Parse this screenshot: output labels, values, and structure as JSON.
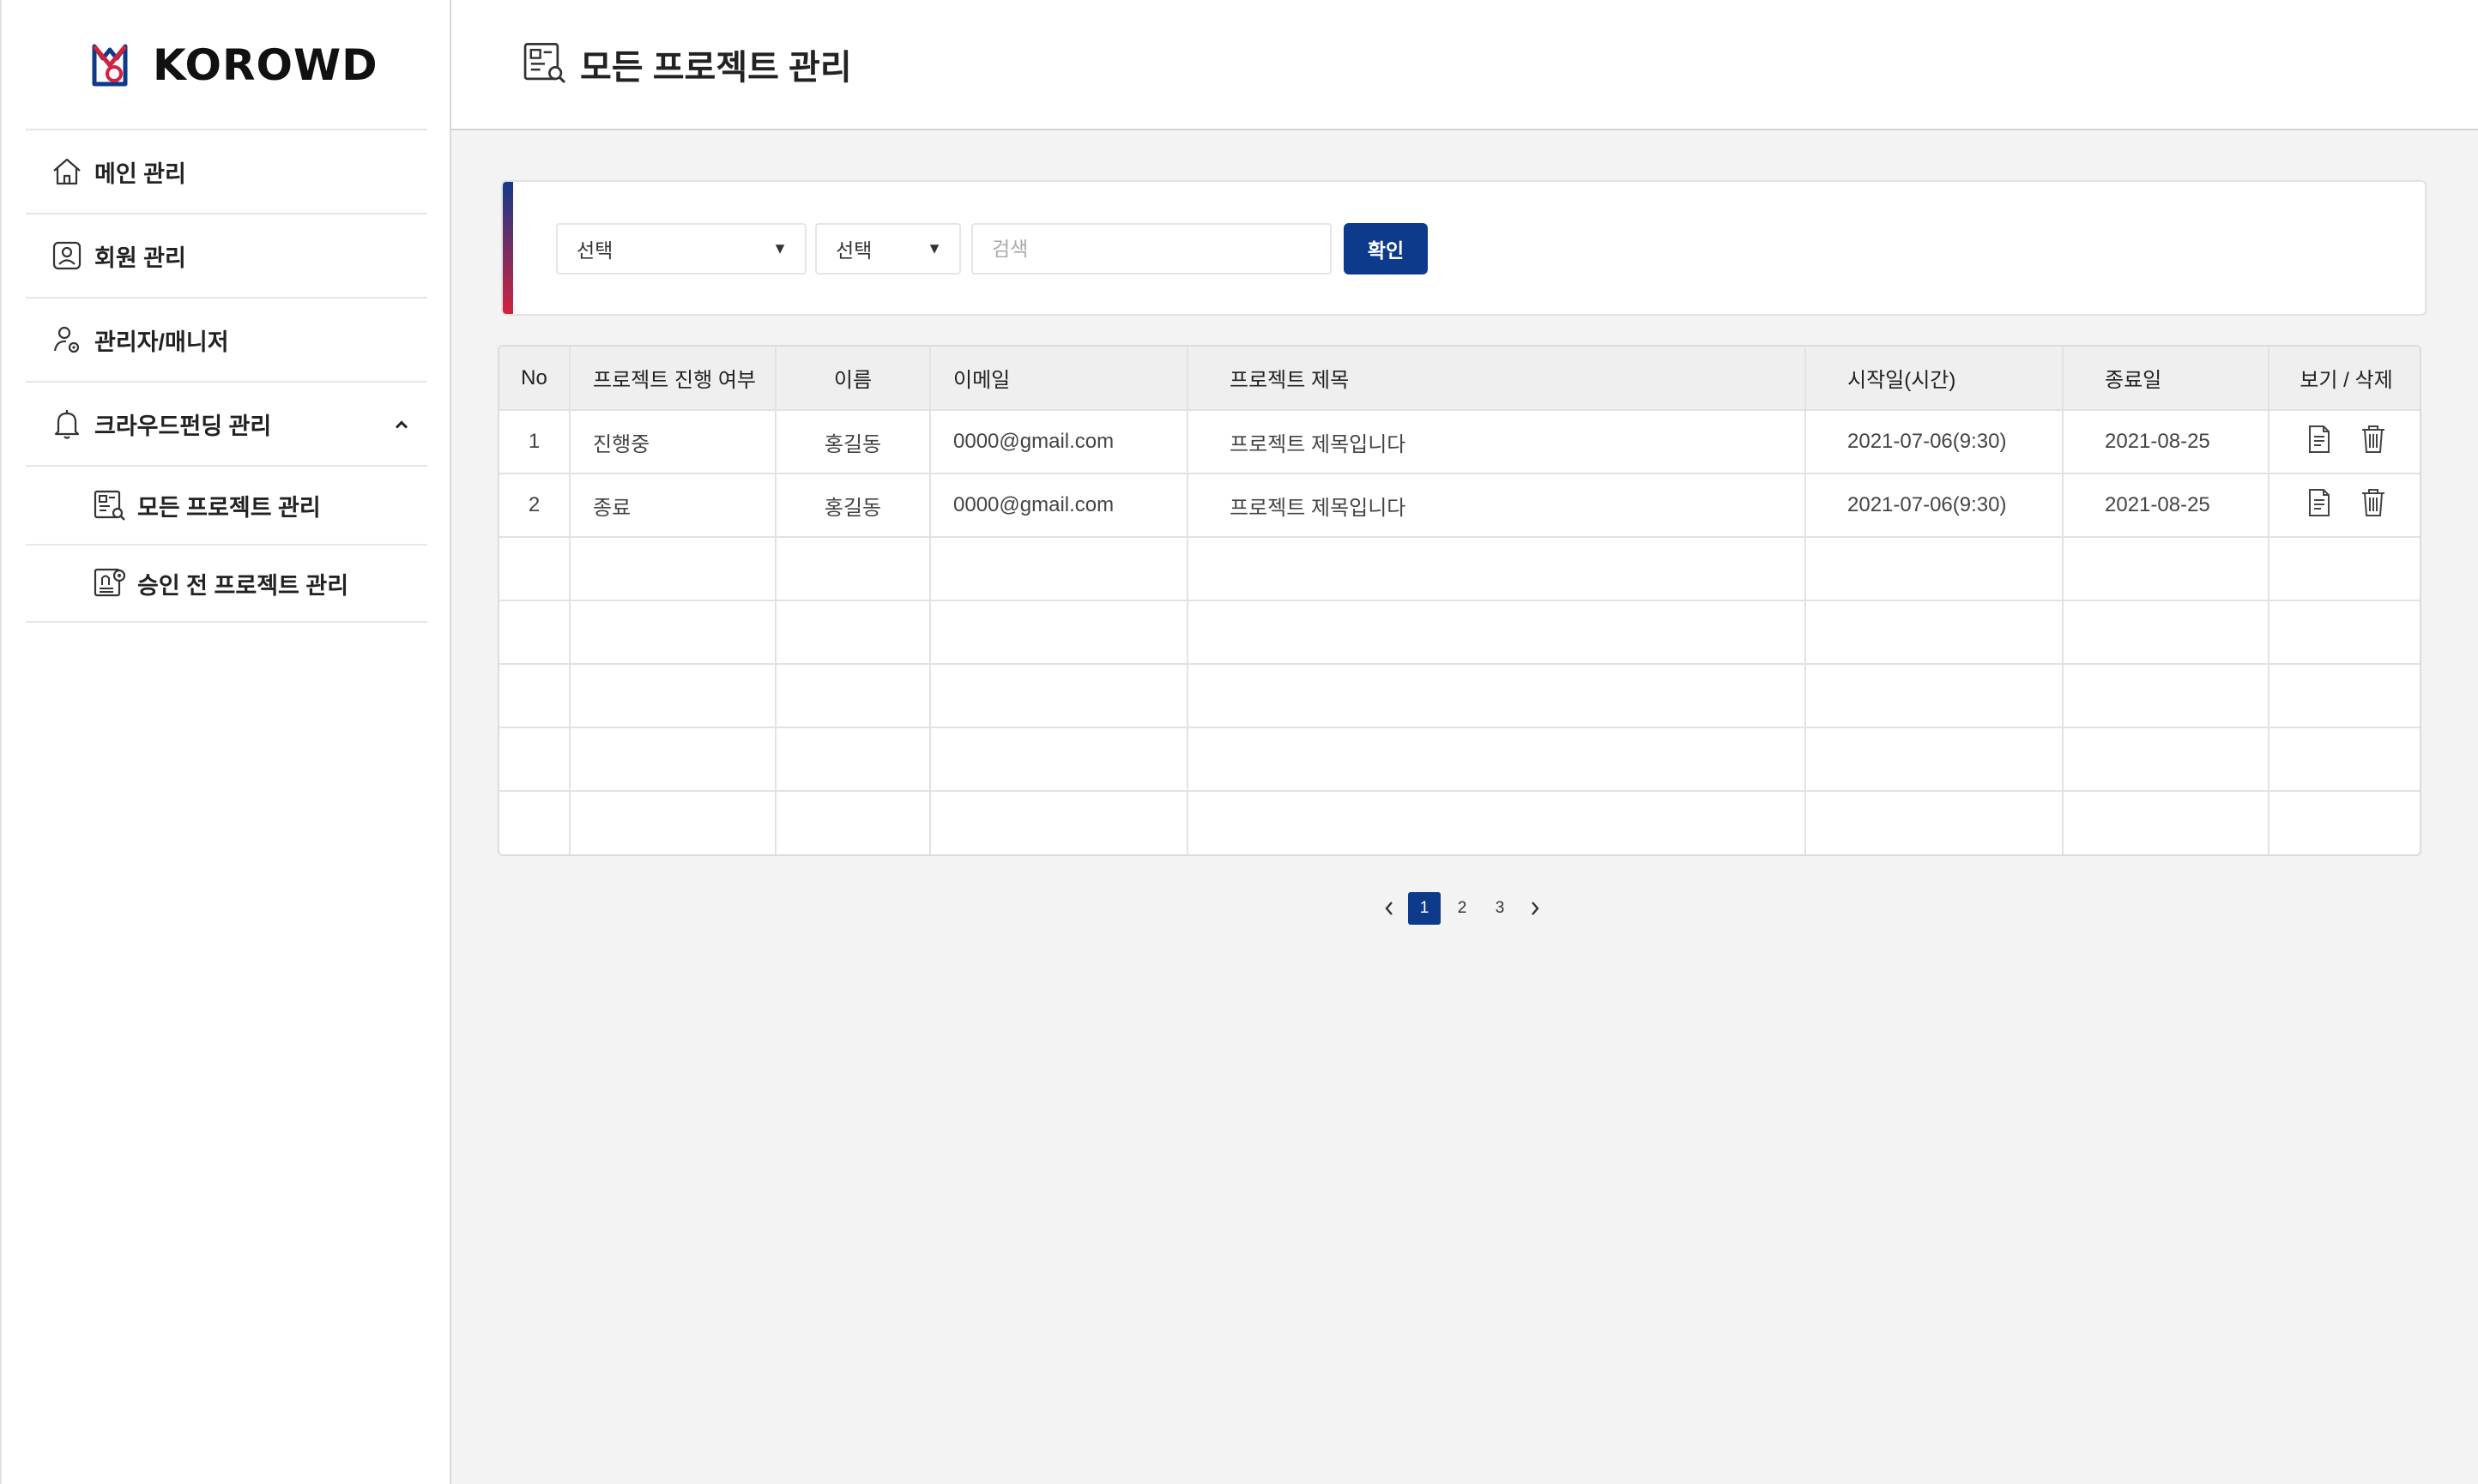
{
  "brand": {
    "name": "KOROWD"
  },
  "sidebar": {
    "items": [
      {
        "label": "메인 관리",
        "icon": "home-icon"
      },
      {
        "label": "회원 관리",
        "icon": "member-card-icon"
      },
      {
        "label": "관리자/매니저",
        "icon": "manager-gear-icon"
      },
      {
        "label": "크라우드펀딩 관리",
        "icon": "bell-icon",
        "expanded": true
      },
      {
        "label": "모든 프로젝트 관리",
        "icon": "document-search-icon"
      },
      {
        "label": "승인 전 프로젝트 관리",
        "icon": "document-approve-icon"
      }
    ]
  },
  "header": {
    "title": "모든 프로젝트 관리",
    "icon": "document-search-icon"
  },
  "search": {
    "select1": "선택",
    "select2": "선택",
    "placeholder": "검색",
    "confirm_label": "확인"
  },
  "table": {
    "headers": [
      "No",
      "프로젝트 진행 여부",
      "이름",
      "이메일",
      "프로젝트 제목",
      "시작일(시간)",
      "종료일",
      "보기 / 삭제"
    ],
    "rows": [
      [
        "1",
        "진행중",
        "홍길동",
        "0000@gmail.com",
        "프로젝트 제목입니다",
        "2021-07-06(9:30)",
        "2021-08-25"
      ],
      [
        "2",
        "종료",
        "홍길동",
        "0000@gmail.com",
        "프로젝트 제목입니다",
        "2021-07-06(9:30)",
        "2021-08-25"
      ]
    ]
  },
  "pagination": {
    "pages": [
      "1",
      "2",
      "3"
    ],
    "current": "1"
  },
  "colors": {
    "accent": "#0d3a8a",
    "accent_red": "#d2223e"
  }
}
